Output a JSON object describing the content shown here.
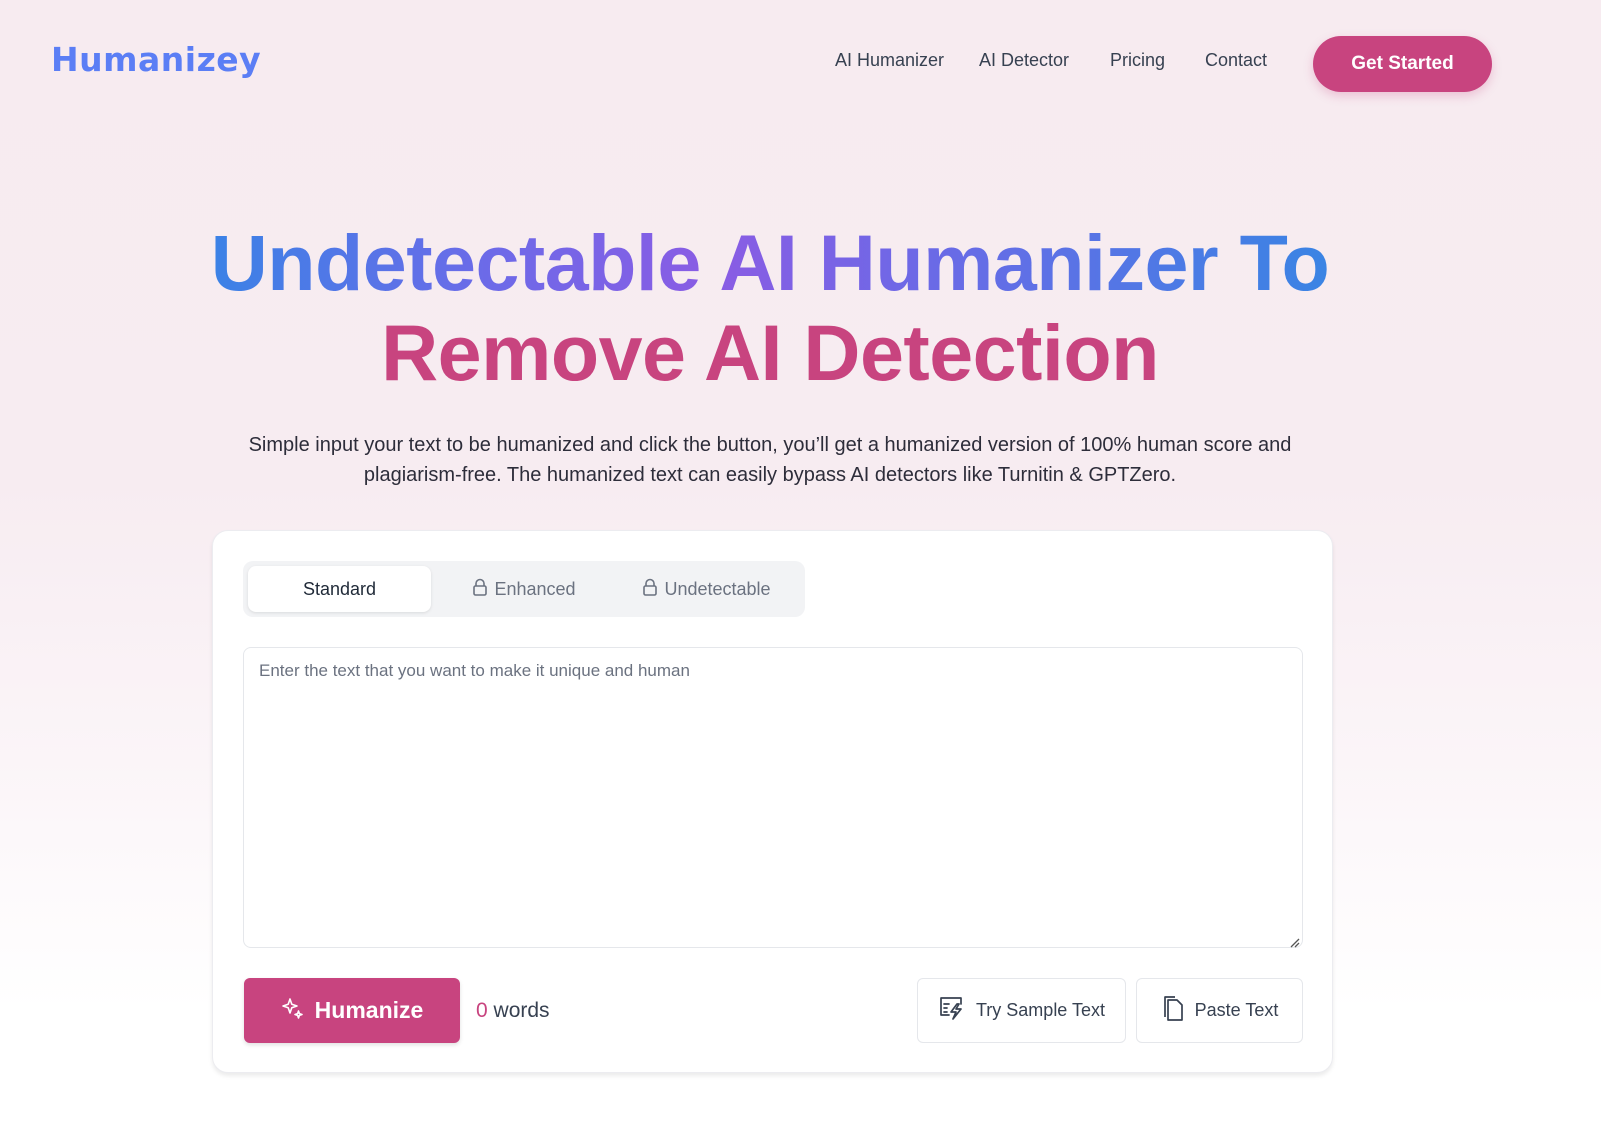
{
  "brand": {
    "name": "Humanizey",
    "accent": "#c8447f",
    "logo_color": "#5b7ef5"
  },
  "nav": {
    "links": [
      {
        "label": "AI Humanizer"
      },
      {
        "label": "AI Detector"
      },
      {
        "label": "Pricing"
      },
      {
        "label": "Contact"
      }
    ],
    "cta_label": "Get Started"
  },
  "hero": {
    "title_line1": "Undetectable AI Humanizer To",
    "title_line2": "Remove AI Detection",
    "subtitle": "Simple input your text to be humanized and click the button, you’ll get a humanized version of 100% human score and plagiarism-free. The humanized text can easily bypass AI detectors like Turnitin & GPTZero."
  },
  "editor": {
    "modes": [
      {
        "label": "Standard",
        "active": true,
        "locked": false
      },
      {
        "label": "Enhanced",
        "active": false,
        "locked": true,
        "icon": "lock-icon"
      },
      {
        "label": "Undetectable",
        "active": false,
        "locked": true,
        "icon": "lock-icon"
      }
    ],
    "input": {
      "value": "",
      "placeholder": "Enter the text that you want to make it unique and human"
    },
    "humanize_label": "Humanize",
    "humanize_icon": "sparkles-icon",
    "word_count": "0",
    "word_count_suffix": "words",
    "sample_label": "Try Sample Text",
    "sample_icon": "sample-text-icon",
    "paste_label": "Paste Text",
    "paste_icon": "copy-icon"
  }
}
